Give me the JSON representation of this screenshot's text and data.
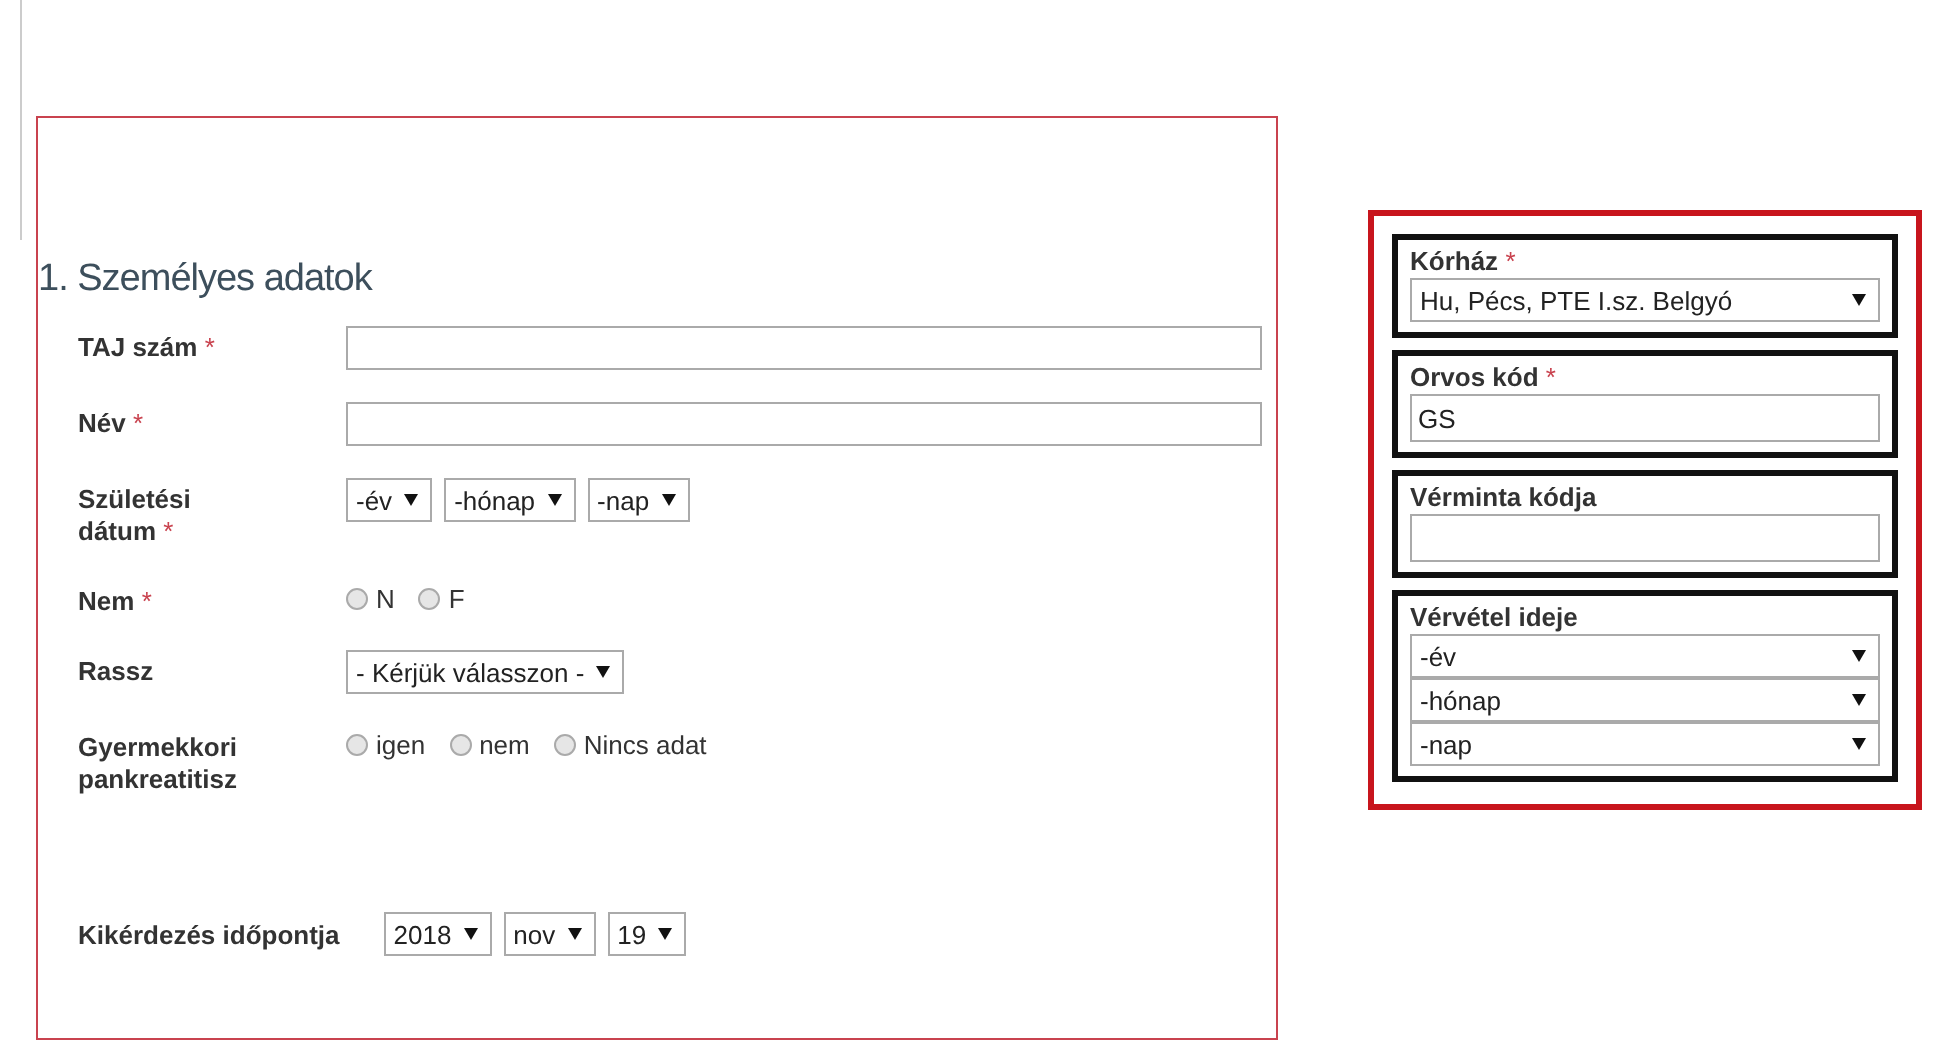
{
  "personal": {
    "title": "1. Személyes adatok",
    "fields": [
      {
        "kind": "text",
        "label": "TAJ szám",
        "mark": "*"
      },
      {
        "kind": "text",
        "label": "Név",
        "mark": "*"
      },
      {
        "kind": "selects",
        "label": "Születési dátum",
        "mark": "*",
        "selects": [
          "-év",
          "-hónap",
          "-nap"
        ]
      },
      {
        "kind": "radio",
        "label": "Nem",
        "mark": "*",
        "options": [
          {
            "label": "N",
            "selected": false
          },
          {
            "label": "F",
            "selected": false
          }
        ]
      },
      {
        "kind": "selects",
        "label": "Rassz",
        "selects": [
          "- Kérjük válasszon -"
        ]
      },
      {
        "kind": "radio",
        "label": "Gyermekkori pankreatitisz",
        "options": [
          {
            "label": "igen",
            "selected": false
          },
          {
            "label": "nem",
            "selected": false
          },
          {
            "label": "Nincs adat",
            "selected": false
          }
        ]
      }
    ],
    "interview_date": {
      "label": "Kikérdezés időpontja",
      "selects": [
        "2018",
        "nov",
        "19"
      ]
    }
  },
  "side_panel": {
    "boxes": [
      {
        "kind": "select",
        "label": "Kórház",
        "mark": "*",
        "value": "Hu, Pécs, PTE I.sz. Belgyó"
      },
      {
        "kind": "text",
        "label": "Orvos kód",
        "mark": "*",
        "value": "GS"
      },
      {
        "kind": "text",
        "label": "Vérminta kódja"
      },
      {
        "kind": "selects",
        "label": "Vérvétel ideje",
        "selects": [
          "-év",
          "-hónap",
          "-nap"
        ]
      }
    ]
  }
}
